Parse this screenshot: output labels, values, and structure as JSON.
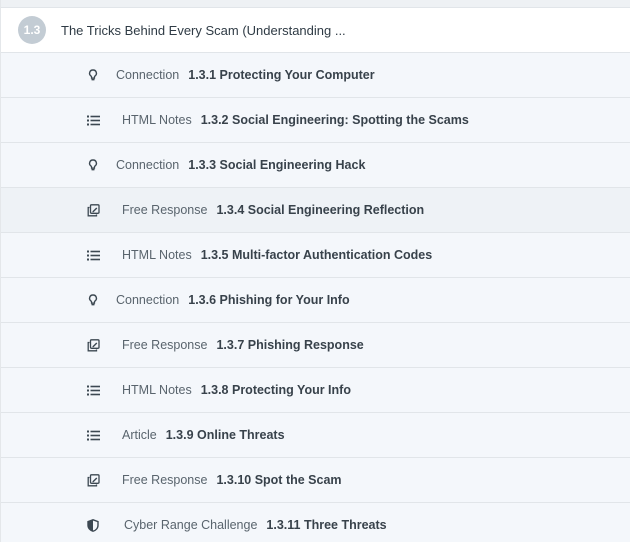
{
  "section": {
    "number": "1.3",
    "title": "The Tricks Behind Every Scam (Understanding ..."
  },
  "colors": {
    "badge": "#c3ccd4",
    "row_background": "#f4f7fb",
    "row_border": "#e1e5e9",
    "text": "#38424b"
  },
  "items": [
    {
      "icon": "lightbulb-icon",
      "type": "Connection",
      "title": "1.3.1 Protecting Your Computer"
    },
    {
      "icon": "list-icon",
      "type": "HTML Notes",
      "title": "1.3.2 Social Engineering: Spotting the Scams"
    },
    {
      "icon": "lightbulb-icon",
      "type": "Connection",
      "title": "1.3.3 Social Engineering Hack"
    },
    {
      "icon": "copy-edit-icon",
      "type": "Free Response",
      "title": "1.3.4 Social Engineering Reflection"
    },
    {
      "icon": "list-icon",
      "type": "HTML Notes",
      "title": "1.3.5 Multi-factor Authentication Codes"
    },
    {
      "icon": "lightbulb-icon",
      "type": "Connection",
      "title": "1.3.6 Phishing for Your Info"
    },
    {
      "icon": "copy-edit-icon",
      "type": "Free Response",
      "title": "1.3.7 Phishing Response"
    },
    {
      "icon": "list-icon",
      "type": "HTML Notes",
      "title": "1.3.8 Protecting Your Info"
    },
    {
      "icon": "list-icon",
      "type": "Article",
      "title": "1.3.9 Online Threats"
    },
    {
      "icon": "copy-edit-icon",
      "type": "Free Response",
      "title": "1.3.10 Spot the Scam"
    },
    {
      "icon": "shield-icon",
      "type": "Cyber Range Challenge",
      "title": "1.3.11 Three Threats"
    }
  ]
}
